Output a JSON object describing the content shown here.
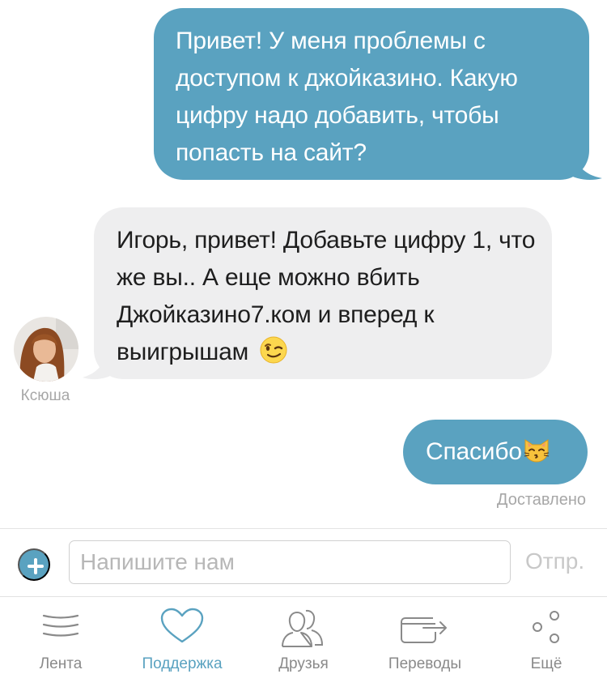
{
  "messages": [
    {
      "direction": "out",
      "text": "Привет! У меня проблемы с доступом к джойказино. Какую цифру надо добавить, чтобы попасть на сайт?"
    },
    {
      "direction": "in",
      "text": "Игорь, привет! Добавьте цифру 1, что же вы.. А еще можно вбить Джойказино7.ком и вперед к выигрышам",
      "emoji": "winking-face",
      "sender": "Ксюша"
    },
    {
      "direction": "out",
      "text": "Спасибо",
      "emoji": "kissing-cat-face",
      "status": "Доставлено"
    }
  ],
  "composer": {
    "placeholder": "Напишите нам",
    "send_label": "Отпр."
  },
  "tabs": [
    {
      "label": "Лента",
      "icon": "feed-icon",
      "active": false
    },
    {
      "label": "Поддержка",
      "icon": "heart-icon",
      "active": true
    },
    {
      "label": "Друзья",
      "icon": "friends-icon",
      "active": false
    },
    {
      "label": "Переводы",
      "icon": "transfer-icon",
      "active": false
    },
    {
      "label": "Ещё",
      "icon": "more-icon",
      "active": false
    }
  ],
  "colors": {
    "accent": "#5aa2c0",
    "incoming_bubble": "#eeeeef",
    "inactive": "#8a8a8a"
  }
}
